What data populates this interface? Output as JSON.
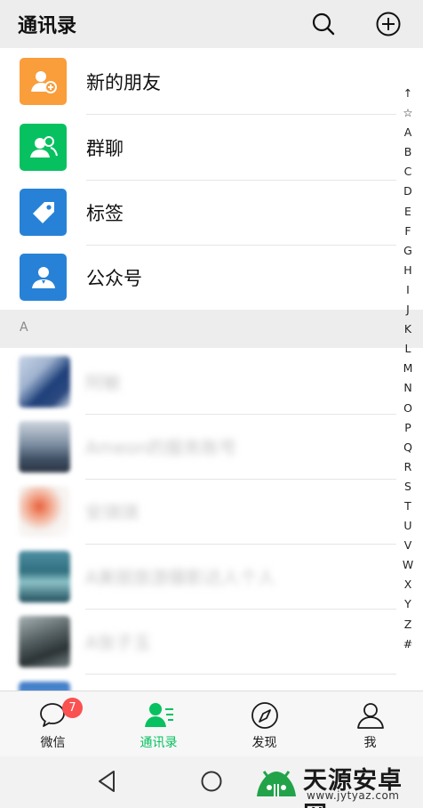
{
  "header": {
    "title": "通讯录"
  },
  "functions": [
    {
      "label": "新的朋友",
      "color": "#fa9d3b",
      "icon": "add-friend-icon"
    },
    {
      "label": "群聊",
      "color": "#07c160",
      "icon": "group-icon"
    },
    {
      "label": "标签",
      "color": "#2782d7",
      "icon": "tag-icon"
    },
    {
      "label": "公众号",
      "color": "#2782d7",
      "icon": "official-account-icon"
    }
  ],
  "section": {
    "letter": "A"
  },
  "contacts": [
    {
      "name": "阿敏"
    },
    {
      "name": "Ameon的服务账号"
    },
    {
      "name": "安琪琪"
    },
    {
      "name": "A美丽旅游摄影达人个人"
    },
    {
      "name": "A张子玉"
    }
  ],
  "index_letters": [
    "↑",
    "☆",
    "A",
    "B",
    "C",
    "D",
    "E",
    "F",
    "G",
    "H",
    "I",
    "J",
    "K",
    "L",
    "M",
    "N",
    "O",
    "P",
    "Q",
    "R",
    "S",
    "T",
    "U",
    "V",
    "W",
    "X",
    "Y",
    "Z",
    "#"
  ],
  "tabs": [
    {
      "label": "微信",
      "icon": "chat-icon",
      "badge": "7"
    },
    {
      "label": "通讯录",
      "icon": "contacts-icon",
      "active": true
    },
    {
      "label": "发现",
      "icon": "compass-icon"
    },
    {
      "label": "我",
      "icon": "person-icon"
    }
  ],
  "watermark": {
    "title": "天源安卓网",
    "url": "www.jytyaz.com"
  },
  "colors": {
    "accent": "#07c160",
    "badge": "#fa5151",
    "header_bg": "#ededed"
  }
}
